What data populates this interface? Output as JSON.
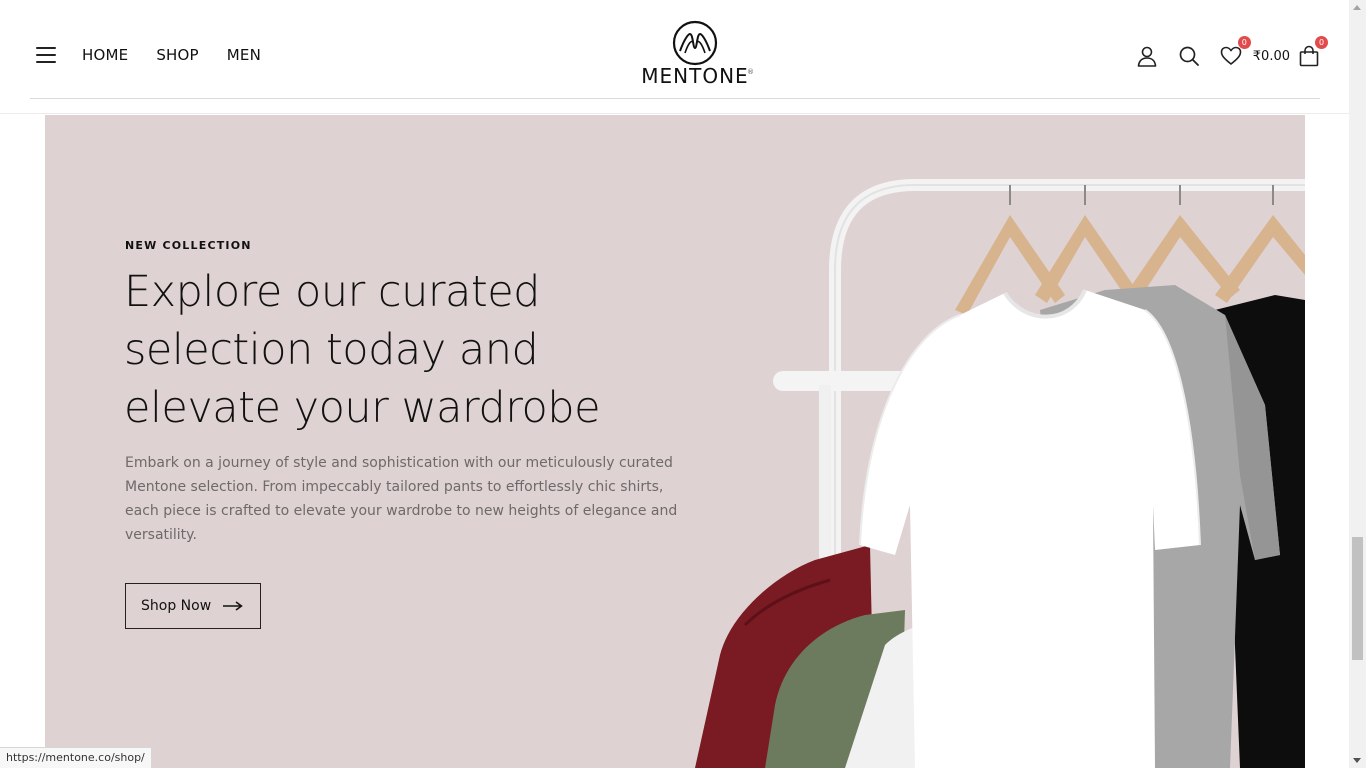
{
  "header": {
    "menu_icon": "hamburger-icon",
    "nav": [
      {
        "label": "HOME"
      },
      {
        "label": "SHOP"
      },
      {
        "label": "MEN"
      }
    ],
    "logo": {
      "text": "MENTONE",
      "reg": "®"
    },
    "account_icon": "user-icon",
    "search_icon": "search-icon",
    "wishlist": {
      "icon": "heart-icon",
      "count": "0"
    },
    "cart": {
      "total": "₹0.00",
      "icon": "shopping-bag-icon",
      "count": "0"
    }
  },
  "hero": {
    "eyebrow": "NEW COLLECTION",
    "headline": "Explore our curated selection today and elevate your wardrobe",
    "description": "Embark on a journey of style and sophistication with our meticulously curated Mentone selection. From impeccably tailored pants to effortlessly chic shirts, each piece is crafted to elevate your wardrobe to new heights of elegance and versatility.",
    "cta": "Shop Now",
    "background": "#dfd2d3"
  },
  "status_bar": {
    "url": "https://mentone.co/shop/"
  }
}
